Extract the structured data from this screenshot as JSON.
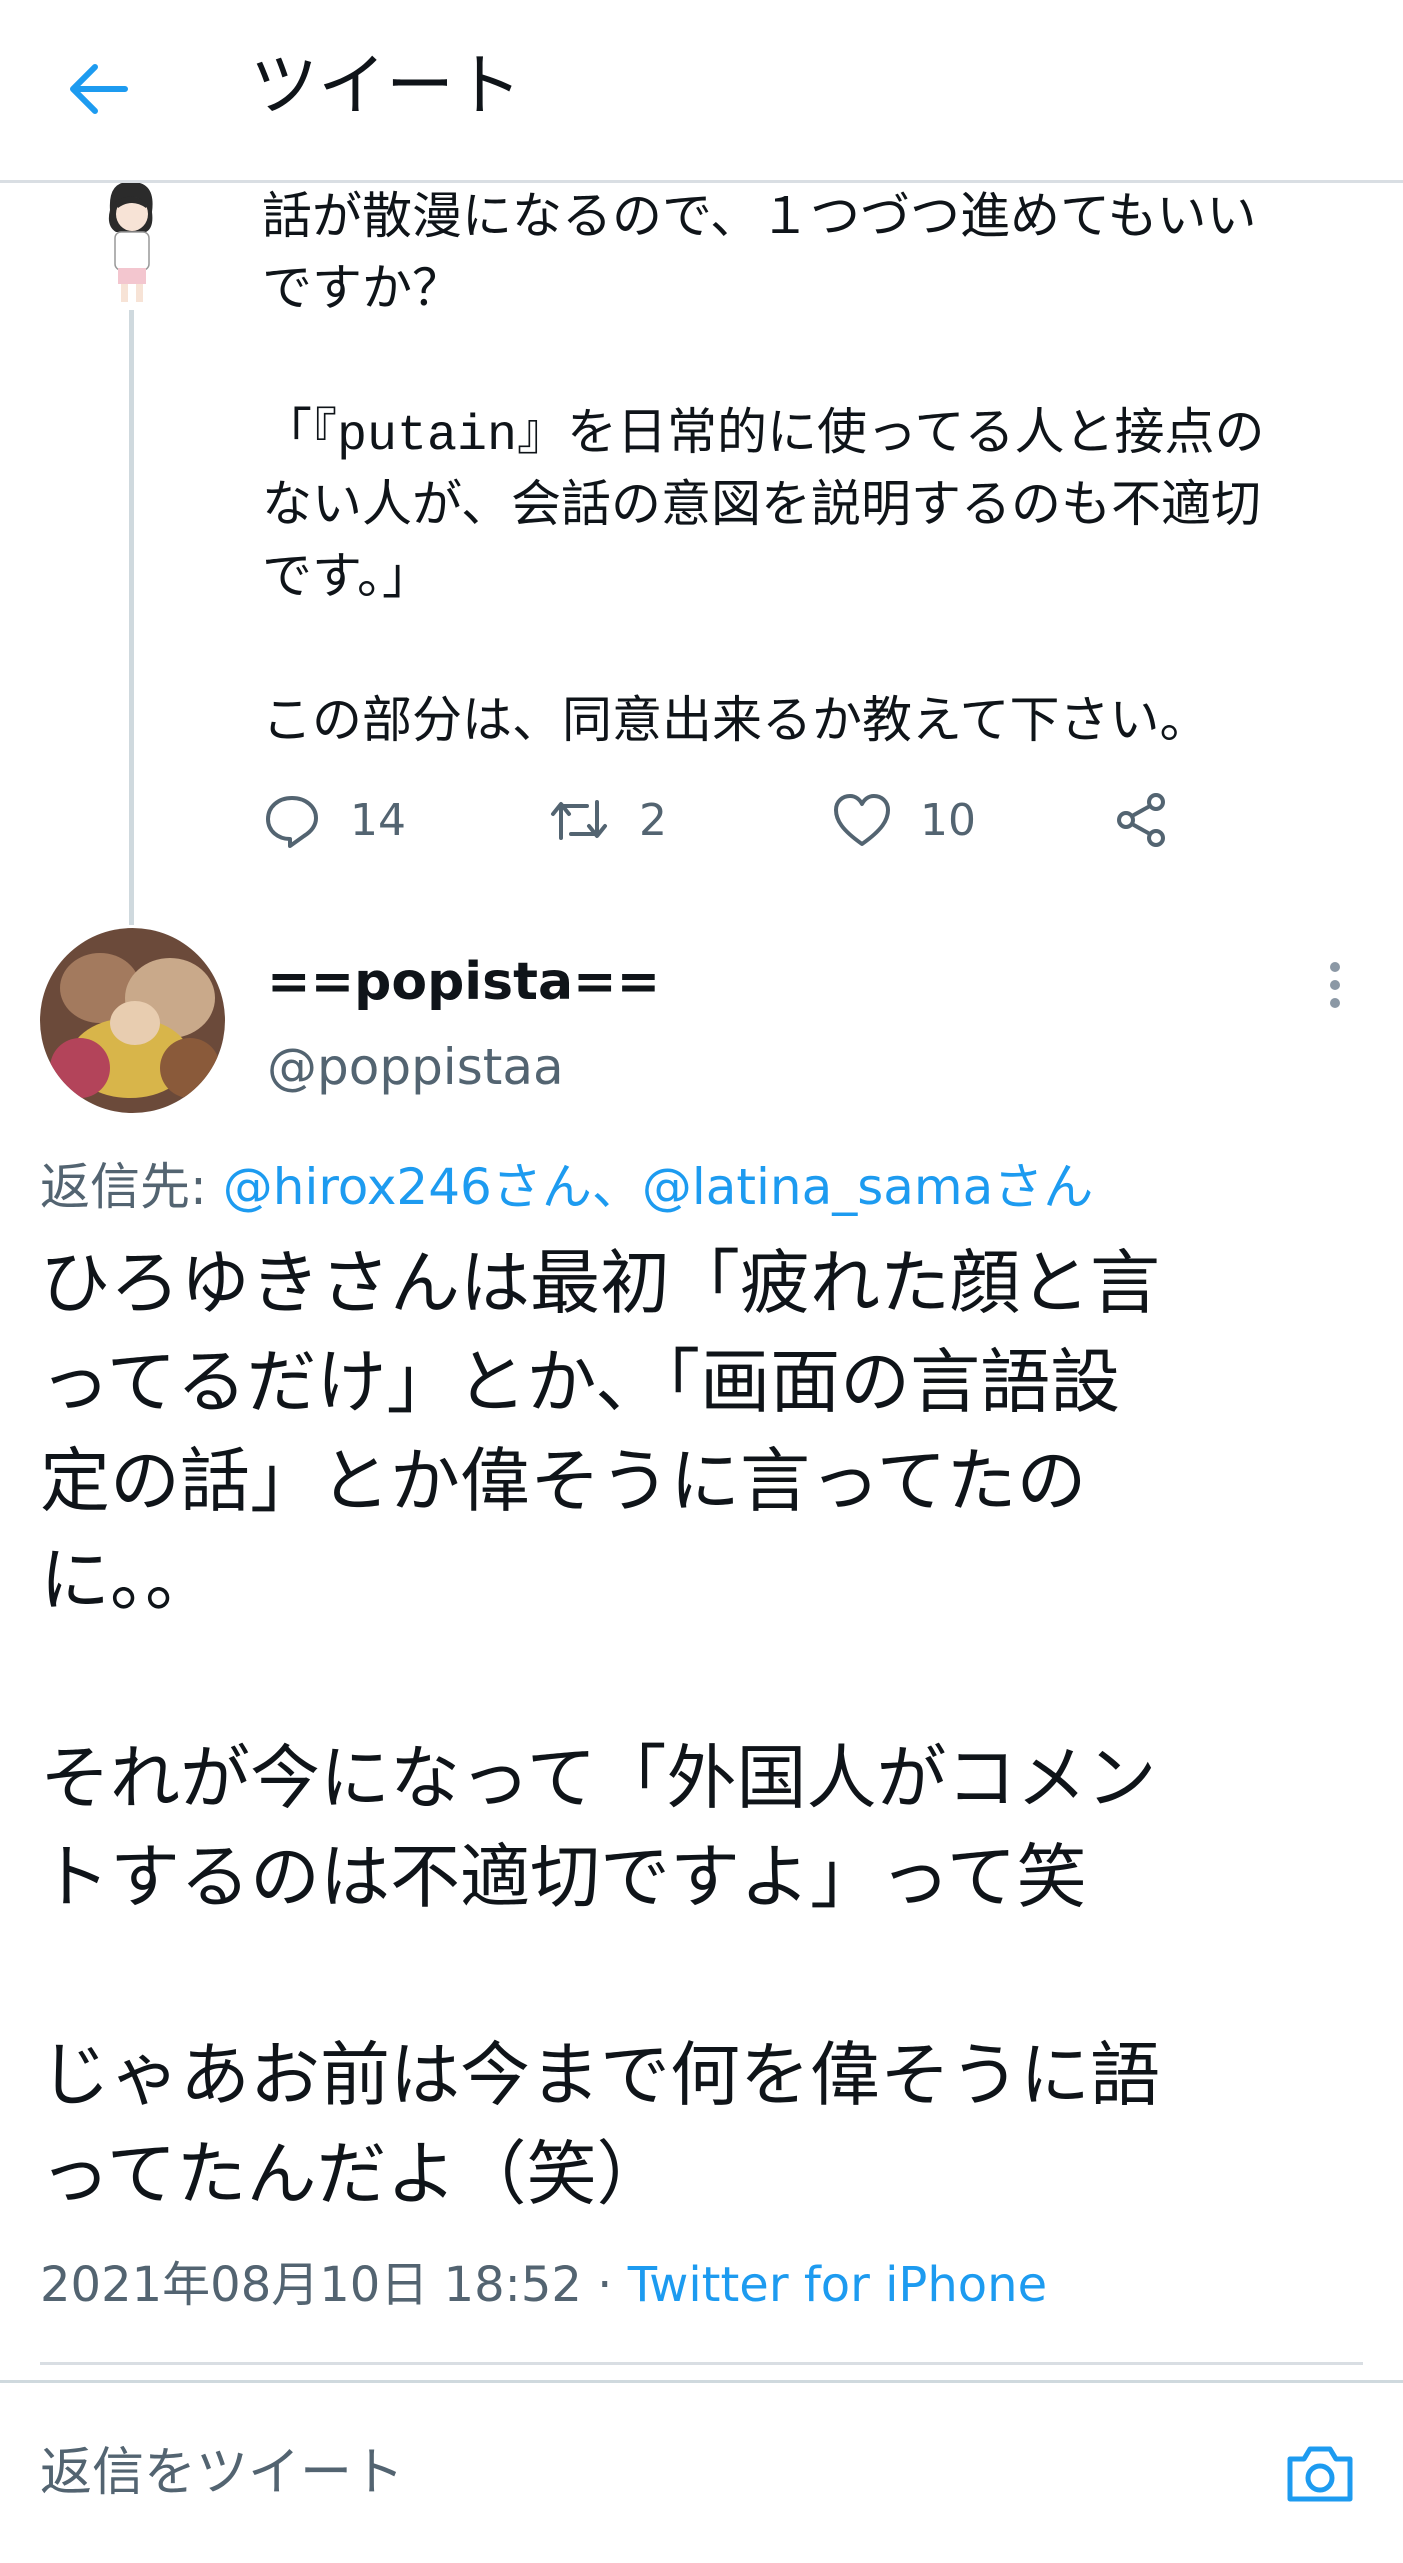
{
  "colors": {
    "accent": "#1d9bf0",
    "secondary_text": "#536471",
    "primary_text": "#0f1419",
    "divider": "#d9dee3"
  },
  "header": {
    "title": "ツイート",
    "back_icon": "arrow-left-icon"
  },
  "parent_tweet": {
    "text": "話が散漫になるので、１つづつ進めてもいい\nですか？\n\n「『putain』を日常的に使ってる人と接点の\nない人が、会話の意図を説明するのも不適切\nです。」\n\nこの部分は、同意出来るか教えて下さい。",
    "replies": "14",
    "retweets": "2",
    "likes": "10"
  },
  "main_tweet": {
    "display_name": "==popista==",
    "handle": "@poppistaa",
    "reply_prefix": "返信先: ",
    "reply_mentions": "@hirox246さん、@latina_samaさん",
    "text": "ひろゆきさんは最初「疲れた顔と言\nってるだけ」とか、「画面の言語設\n定の話」とか偉そうに言ってたの\nに。。\n\nそれが今になって「外国人がコメン\nトするのは不適切ですよ」って笑\n\nじゃあお前は今まで何を偉そうに語\nってたんだよ（笑）",
    "timestamp": "2021年08月10日 18:52 · ",
    "source": "Twitter for iPhone"
  },
  "composer": {
    "placeholder": "返信をツイート",
    "camera_icon": "camera-icon"
  }
}
